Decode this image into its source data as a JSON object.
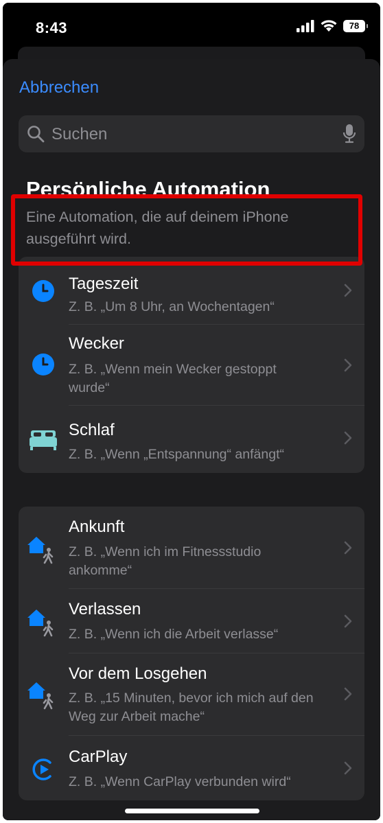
{
  "status_bar": {
    "time": "8:43",
    "battery": "78"
  },
  "nav": {
    "cancel_label": "Abbrechen"
  },
  "search": {
    "placeholder": "Suchen"
  },
  "header": {
    "title": "Persönliche Automation",
    "subtitle": "Eine Automation, die auf deinem iPhone ausgeführt wird."
  },
  "group1": [
    {
      "title": "Tageszeit",
      "subtitle": "Z. B. „Um 8 Uhr, an Wochentagen“",
      "icon": "clock-icon",
      "highlighted": true
    },
    {
      "title": "Wecker",
      "subtitle": "Z. B. „Wenn mein Wecker gestoppt wurde“",
      "icon": "alarm-clock-icon"
    },
    {
      "title": "Schlaf",
      "subtitle": "Z. B. „Wenn „Entspannung“ anfängt“",
      "icon": "bed-icon"
    }
  ],
  "group2": [
    {
      "title": "Ankunft",
      "subtitle": "Z. B. „Wenn ich im Fitnessstudio ankomme“",
      "icon": "home-arrive-icon"
    },
    {
      "title": "Verlassen",
      "subtitle": "Z. B. „Wenn ich die Arbeit verlasse“",
      "icon": "home-leave-icon"
    },
    {
      "title": "Vor dem Losgehen",
      "subtitle": "Z. B. „15 Minuten, bevor ich mich auf den Weg zur Arbeit mache“",
      "icon": "home-depart-icon"
    },
    {
      "title": "CarPlay",
      "subtitle": "Z. B. „Wenn CarPlay verbunden wird“",
      "icon": "carplay-icon"
    }
  ],
  "colors": {
    "accent": "#3b8cff",
    "highlight": "#e00000",
    "bed": "#7fd3d3"
  }
}
